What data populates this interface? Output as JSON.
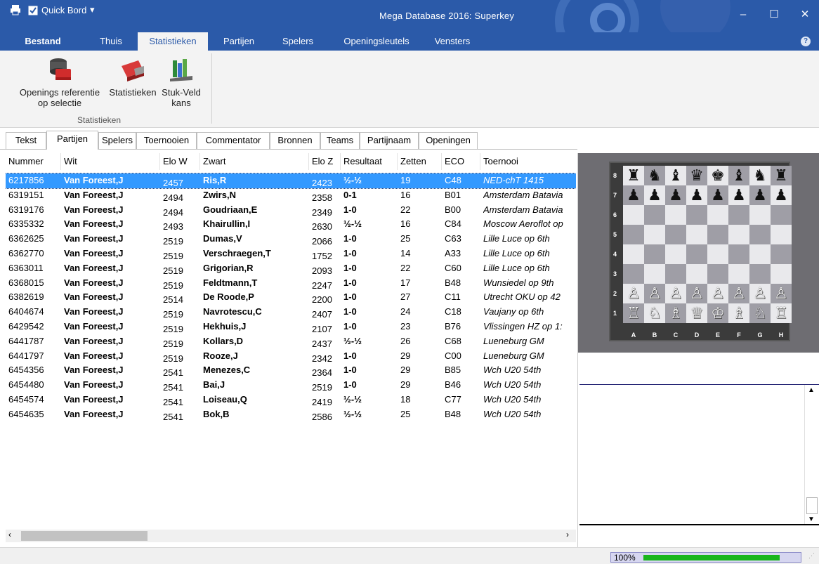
{
  "titlebar": {
    "quickbar_label": "Quick Bord",
    "title": "Mega Database 2016:  Superkey",
    "minimize": "–",
    "maximize": "☐",
    "close": "✕"
  },
  "ribbon_tabs": [
    "Bestand",
    "Thuis",
    "Statistieken",
    "Partijen",
    "Spelers",
    "Openingsleutels",
    "Vensters"
  ],
  "ribbon": {
    "buttons": [
      {
        "line1": "Openings referentie",
        "line2": "op selectie"
      },
      {
        "line1": "Statistieken",
        "line2": ""
      },
      {
        "line1": "Stuk-Veld",
        "line2": "kans"
      }
    ],
    "group_label": "Statistieken"
  },
  "tabs": [
    "Tekst",
    "Partijen",
    "Spelers",
    "Toernooien",
    "Commentator",
    "Bronnen",
    "Teams",
    "Partijnaam",
    "Openingen"
  ],
  "columns": [
    "Nummer",
    "Wit",
    "Elo W",
    "Zwart",
    "Elo Z",
    "Resultaat",
    "Zetten",
    "ECO",
    "Toernooi"
  ],
  "rows": [
    [
      "6217856",
      "Van Foreest,J",
      "2457",
      "Ris,R",
      "2423",
      "½-½",
      "19",
      "C48",
      "NED-chT 1415"
    ],
    [
      "6319151",
      "Van Foreest,J",
      "2494",
      "Zwirs,N",
      "2358",
      "0-1",
      "16",
      "B01",
      "Amsterdam Batavia"
    ],
    [
      "6319176",
      "Van Foreest,J",
      "2494",
      "Goudriaan,E",
      "2349",
      "1-0",
      "22",
      "B00",
      "Amsterdam Batavia"
    ],
    [
      "6335332",
      "Van Foreest,J",
      "2493",
      "Khairullin,I",
      "2630",
      "½-½",
      "16",
      "C84",
      "Moscow Aeroflot op"
    ],
    [
      "6362625",
      "Van Foreest,J",
      "2519",
      "Dumas,V",
      "2066",
      "1-0",
      "25",
      "C63",
      "Lille Luce op 6th"
    ],
    [
      "6362770",
      "Van Foreest,J",
      "2519",
      "Verschraegen,T",
      "1752",
      "1-0",
      "14",
      "A33",
      "Lille Luce op 6th"
    ],
    [
      "6363011",
      "Van Foreest,J",
      "2519",
      "Grigorian,R",
      "2093",
      "1-0",
      "22",
      "C60",
      "Lille Luce op 6th"
    ],
    [
      "6368015",
      "Van Foreest,J",
      "2519",
      "Feldtmann,T",
      "2247",
      "1-0",
      "17",
      "B48",
      "Wunsiedel op 9th"
    ],
    [
      "6382619",
      "Van Foreest,J",
      "2514",
      "De Roode,P",
      "2200",
      "1-0",
      "27",
      "C11",
      "Utrecht OKU op 42"
    ],
    [
      "6404674",
      "Van Foreest,J",
      "2519",
      "Navrotescu,C",
      "2407",
      "1-0",
      "24",
      "C18",
      "Vaujany op 6th"
    ],
    [
      "6429542",
      "Van Foreest,J",
      "2519",
      "Hekhuis,J",
      "2107",
      "1-0",
      "23",
      "B76",
      "Vlissingen HZ op 1:"
    ],
    [
      "6441787",
      "Van Foreest,J",
      "2519",
      "Kollars,D",
      "2437",
      "½-½",
      "26",
      "C68",
      "Lueneburg GM"
    ],
    [
      "6441797",
      "Van Foreest,J",
      "2519",
      "Rooze,J",
      "2342",
      "1-0",
      "29",
      "C00",
      "Lueneburg GM"
    ],
    [
      "6454356",
      "Van Foreest,J",
      "2541",
      "Menezes,C",
      "2364",
      "1-0",
      "29",
      "B85",
      "Wch U20 54th"
    ],
    [
      "6454480",
      "Van Foreest,J",
      "2541",
      "Bai,J",
      "2519",
      "1-0",
      "29",
      "B46",
      "Wch U20 54th"
    ],
    [
      "6454574",
      "Van Foreest,J",
      "2541",
      "Loiseau,Q",
      "2419",
      "½-½",
      "18",
      "C77",
      "Wch U20 54th"
    ],
    [
      "6454635",
      "Van Foreest,J",
      "2541",
      "Bok,B",
      "2586",
      "½-½",
      "25",
      "B48",
      "Wch U20 54th"
    ]
  ],
  "board": {
    "ranks": [
      "8",
      "7",
      "6",
      "5",
      "4",
      "3",
      "2",
      "1"
    ],
    "files": [
      "A",
      "B",
      "C",
      "D",
      "E",
      "F",
      "G",
      "H"
    ],
    "position": [
      "♜♞♝♛♚♝♞♜",
      "♟♟♟♟♟♟♟♟",
      "        ",
      "        ",
      "        ",
      "        ",
      "♙♙♙♙♙♙♙♙",
      "♖♘♗♕♔♗♘♖"
    ]
  },
  "status": {
    "zoom_label": "100%",
    "progress": 0.88
  },
  "colors": {
    "accent": "#2b5aa9",
    "selection": "#3399ff",
    "progress": "#19b61d"
  }
}
